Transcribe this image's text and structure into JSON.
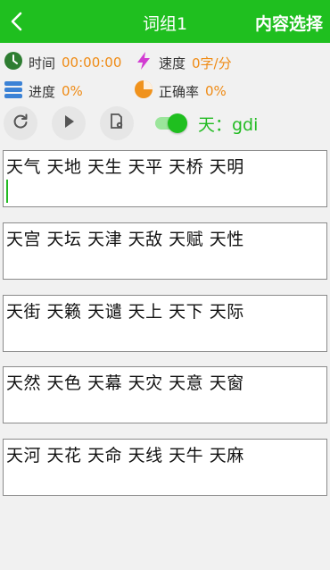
{
  "header": {
    "title": "词组1",
    "right_action": "内容选择"
  },
  "stats": {
    "time": {
      "label": "时间",
      "value": "00:00:00"
    },
    "speed": {
      "label": "速度",
      "value": "0字/分"
    },
    "progress": {
      "label": "进度",
      "value": "0%"
    },
    "accuracy": {
      "label": "正确率",
      "value": "0%"
    }
  },
  "controls": {
    "toggle_on": true,
    "keyboard_hint": "天：gdi"
  },
  "groups": [
    {
      "words": "天气 天地 天生 天平 天桥 天明"
    },
    {
      "words": "天宫 天坛 天津 天敌 天赋 天性"
    },
    {
      "words": "天街 天籁 天谴 天上 天下 天际"
    },
    {
      "words": "天然 天色 天幕 天灾 天意 天窗"
    },
    {
      "words": "天河 天花 天命 天线 天牛 天麻"
    }
  ],
  "colors": {
    "accent": "#1fbf1f",
    "value": "#ef8b15",
    "hint": "#22bb22"
  }
}
